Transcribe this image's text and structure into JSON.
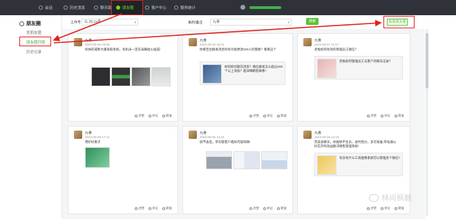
{
  "topnav": {
    "items": [
      {
        "label": "会话"
      },
      {
        "label": "历史消息"
      },
      {
        "label": "聊天助手"
      },
      {
        "label": "朋友圈"
      },
      {
        "label": "客户中心"
      },
      {
        "label": "服务统计"
      }
    ]
  },
  "sidebar": {
    "title": "朋友圈",
    "items": [
      {
        "label": "发朋友圈"
      },
      {
        "label": "朋友圈列表"
      },
      {
        "label": "历史记录"
      }
    ]
  },
  "filters": {
    "account_label": "工作号",
    "account_value": "11.26,1a号",
    "type_label": "来的/备注",
    "type_value": "九骨",
    "search_button": "搜索",
    "publish_button": "新建朋友圈"
  },
  "actions": {
    "like": "点赞",
    "comment": "评论",
    "forward": "转发"
  },
  "cards": [
    {
      "name": "九骨",
      "time": "2023-06-09 15:09",
      "text": "拆掉的戒断大厦采取系统，有机米一定去该瞒给火插成!",
      "images": [
        "dark-chat",
        "green-chat",
        "dark-cat",
        "dark-scene"
      ]
    },
    {
      "name": "九骨",
      "time": "2023-06-09 15:01",
      "text": "你看百合群发消息时有尽规更改200人的需要？看看这个",
      "share_text": "如何如问题向消息？微信群发怎么超过200个以上添加？超详细教程来喽~"
    },
    {
      "name": "九骨",
      "time": "2023-06-07 11:07",
      "text": "老板如何有效的管理员工微信？",
      "share_text": "老板如何管理员工与客户的聊天记录？"
    },
    {
      "name": "九骨",
      "time": "2023-06-08 17:12",
      "text": "用护好看子",
      "images": [
        "product"
      ]
    },
    {
      "name": "九骨",
      "time": "2023-06-06 14:22",
      "text": "屏节会后，带刘管客户唱好内容四顾!",
      "images": [
        "screen1",
        "screen2",
        "screen3"
      ]
    },
    {
      "name": "九骨",
      "time": "2023-06-06 14:19",
      "text": "完美会聊天，你能够不生员，会时努力，多可发展,带动通以好实开有效益解决销售管理系统!",
      "share_text": "有没有什么工具能像系统可以管理多个微信?"
    }
  ],
  "watermark": "林间枫糖"
}
